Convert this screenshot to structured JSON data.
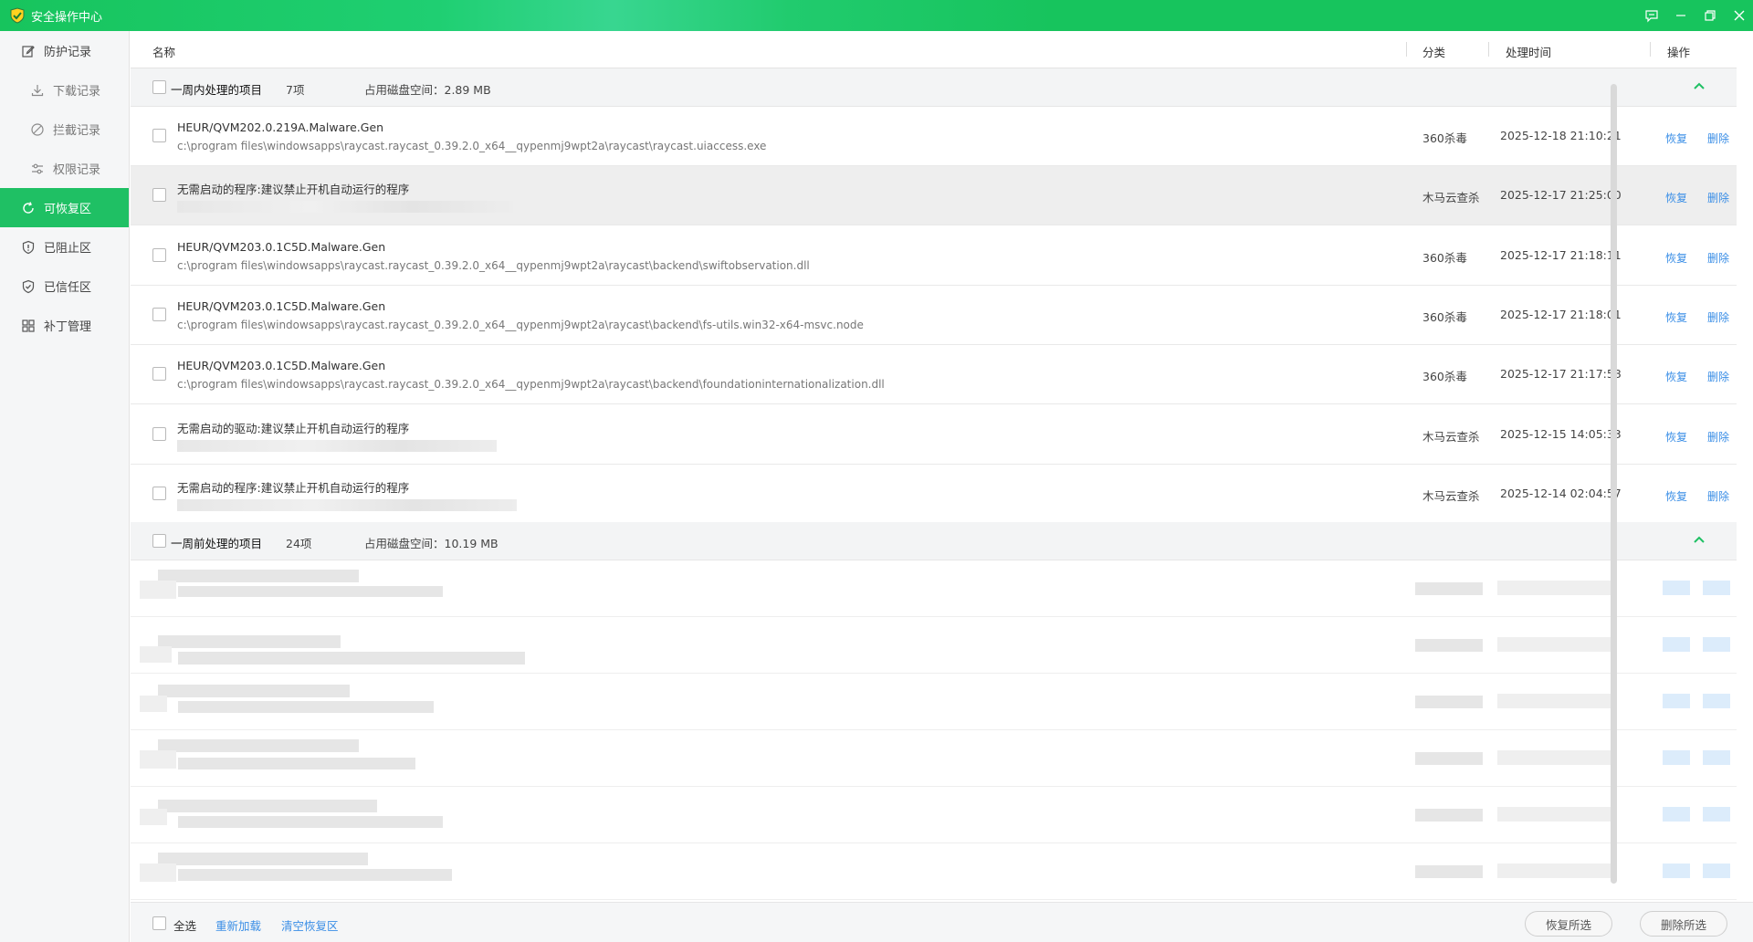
{
  "titlebar": {
    "title": "安全操作中心"
  },
  "sidebar": {
    "items": [
      {
        "label": "防护记录",
        "icon": "edit-icon",
        "sub": false,
        "active": false
      },
      {
        "label": "下载记录",
        "icon": "download-icon",
        "sub": true,
        "active": false
      },
      {
        "label": "拦截记录",
        "icon": "block-icon",
        "sub": true,
        "active": false
      },
      {
        "label": "权限记录",
        "icon": "sliders-icon",
        "sub": true,
        "active": false
      },
      {
        "label": "可恢复区",
        "icon": "refresh-icon",
        "sub": false,
        "active": true
      },
      {
        "label": "已阻止区",
        "icon": "shield-alert-icon",
        "sub": false,
        "active": false
      },
      {
        "label": "已信任区",
        "icon": "shield-check-icon",
        "sub": false,
        "active": false
      },
      {
        "label": "补丁管理",
        "icon": "grid-icon",
        "sub": false,
        "active": false
      }
    ]
  },
  "columns": {
    "name": "名称",
    "category": "分类",
    "time": "处理时间",
    "action": "操作"
  },
  "groups": [
    {
      "title": "一周内处理的项目",
      "count": "7项",
      "space": "占用磁盘空间：2.89 MB"
    },
    {
      "title": "一周前处理的项目",
      "count": "24项",
      "space": "占用磁盘空间：10.19 MB"
    }
  ],
  "rows": [
    {
      "name": "HEUR/QVM202.0.219A.Malware.Gen",
      "path": "c:\\program files\\windowsapps\\raycast.raycast_0.39.2.0_x64__qypenmj9wpt2a\\raycast\\raycast.uiaccess.exe",
      "category": "360杀毒",
      "time": "2025-12-18 21:10:21",
      "restore": "恢复",
      "delete": "删除"
    },
    {
      "name": "无需启动的程序:建议禁止开机自动运行的程序",
      "path": "",
      "category": "木马云查杀",
      "time": "2025-12-17 21:25:00",
      "restore": "恢复",
      "delete": "删除"
    },
    {
      "name": "HEUR/QVM203.0.1C5D.Malware.Gen",
      "path": "c:\\program files\\windowsapps\\raycast.raycast_0.39.2.0_x64__qypenmj9wpt2a\\raycast\\backend\\swiftobservation.dll",
      "category": "360杀毒",
      "time": "2025-12-17 21:18:11",
      "restore": "恢复",
      "delete": "删除"
    },
    {
      "name": "HEUR/QVM203.0.1C5D.Malware.Gen",
      "path": "c:\\program files\\windowsapps\\raycast.raycast_0.39.2.0_x64__qypenmj9wpt2a\\raycast\\backend\\fs-utils.win32-x64-msvc.node",
      "category": "360杀毒",
      "time": "2025-12-17 21:18:01",
      "restore": "恢复",
      "delete": "删除"
    },
    {
      "name": "HEUR/QVM203.0.1C5D.Malware.Gen",
      "path": "c:\\program files\\windowsapps\\raycast.raycast_0.39.2.0_x64__qypenmj9wpt2a\\raycast\\backend\\foundationinternationalization.dll",
      "category": "360杀毒",
      "time": "2025-12-17 21:17:58",
      "restore": "恢复",
      "delete": "删除"
    },
    {
      "name": "无需启动的驱动:建议禁止开机自动运行的程序",
      "path": "",
      "category": "木马云查杀",
      "time": "2025-12-15 14:05:33",
      "restore": "恢复",
      "delete": "删除"
    },
    {
      "name": "无需启动的程序:建议禁止开机自动运行的程序",
      "path": "",
      "category": "木马云查杀",
      "time": "2025-12-14 02:04:57",
      "restore": "恢复",
      "delete": "删除"
    }
  ],
  "footer": {
    "select_all": "全选",
    "reload": "重新加载",
    "clear": "清空恢复区",
    "restore_selected": "恢复所选",
    "delete_selected": "删除所选"
  },
  "colors": {
    "accent": "#1fc064",
    "link": "#3a8ee6"
  }
}
